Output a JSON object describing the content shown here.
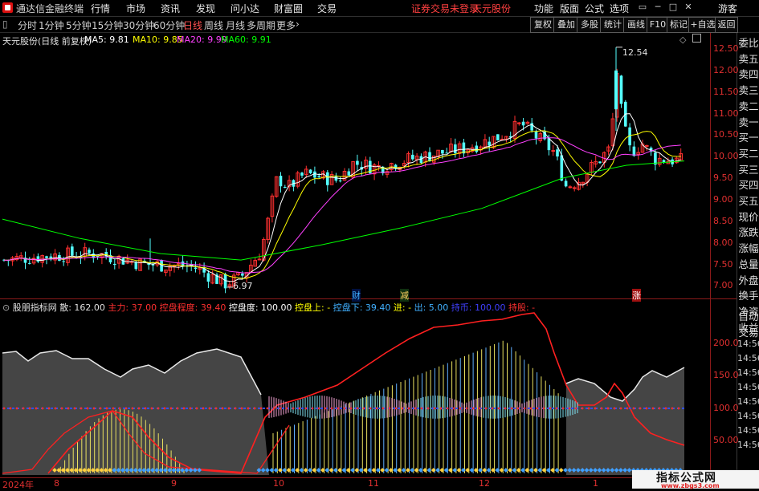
{
  "app": {
    "title": "通达信金融终端",
    "warning": "证券交易未登录",
    "stock": "天元股份",
    "guest": "游客"
  },
  "menu": [
    "行情",
    "市场",
    "资讯",
    "发现",
    "问小达",
    "财富圈",
    "交易"
  ],
  "right_menu": [
    "功能",
    "版面",
    "公式",
    "选项"
  ],
  "periods": [
    "分时",
    "1分钟",
    "5分钟",
    "15分钟",
    "30分钟",
    "60分钟",
    "日线",
    "周线",
    "月线",
    "多周期",
    "更多"
  ],
  "active_period": "日线",
  "right_tools": [
    "复权",
    "叠加",
    "多股",
    "统计",
    "画线",
    "F10",
    "标记",
    "+自选",
    "返回"
  ],
  "side_panel": [
    "委比",
    "卖五",
    "卖四",
    "卖三",
    "卖二",
    "卖一",
    "买一",
    "买二",
    "买三",
    "买四",
    "买五",
    "现价",
    "涨跌",
    "涨幅",
    "总量",
    "外盘",
    "换手",
    "净资",
    "收益"
  ],
  "side_panel2": [
    "自动",
    "交易"
  ],
  "main_legend": {
    "name": "天元股份(日线 前复权)",
    "ma5": "MA5: 9.81",
    "ma10": "MA10: 9.85",
    "ma20": "MA20: 9.99",
    "ma60": "MA60: 9.91",
    "colors": {
      "ma5": "#ffffff",
      "ma10": "#ffff00",
      "ma20": "#ff40ff",
      "ma60": "#00ff00"
    }
  },
  "price_axis": [
    "12.50",
    "12.00",
    "11.50",
    "11.00",
    "10.50",
    "10.00",
    "9.50",
    "9.00",
    "8.50",
    "8.00",
    "7.50",
    "7.00"
  ],
  "annotations": {
    "high": "12.54",
    "low": "6.97",
    "event1": "财",
    "event2": "减",
    "event3": "涨"
  },
  "ind_legend": {
    "name": "股朋指标网",
    "items": [
      {
        "label": "散: 162.00",
        "color": "#e0e0e0"
      },
      {
        "label": "主力: 37.00",
        "color": "#ff3030"
      },
      {
        "label": "控盘程度: 39.40",
        "color": "#ff3030"
      },
      {
        "label": "控盘度: 100.00",
        "color": "#ffffff"
      },
      {
        "label": "控盘上: -",
        "color": "#ffff00"
      },
      {
        "label": "控盘下: 39.40",
        "color": "#40b0ff"
      },
      {
        "label": "进: -",
        "color": "#ffff00"
      },
      {
        "label": "出: 5.00",
        "color": "#40b0ff"
      },
      {
        "label": "持币: 100.00",
        "color": "#4040ff"
      },
      {
        "label": "持股: -",
        "color": "#ff3030"
      }
    ]
  },
  "ind_axis": [
    "200.0",
    "150.0",
    "100.0",
    "50.00"
  ],
  "ind_axis2": [
    "14:56",
    "14:56",
    "14:56",
    "14:56",
    "14:56",
    "14:56",
    "14:56",
    "14:56"
  ],
  "x_axis": [
    "2024年",
    "8",
    "9",
    "10",
    "11",
    "12",
    "1"
  ],
  "watermark": {
    "line1": "指标公式网",
    "line2": "www.zbgs3.com"
  }
}
